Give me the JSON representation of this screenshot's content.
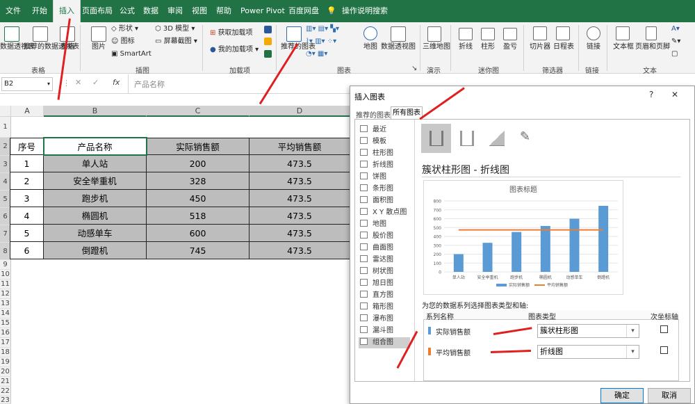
{
  "menu": {
    "tabs": [
      "文件",
      "开始",
      "插入",
      "页面布局",
      "公式",
      "数据",
      "审阅",
      "视图",
      "帮助",
      "Power Pivot",
      "百度网盘"
    ],
    "tell_me": "操作说明搜索"
  },
  "ribbon": {
    "pivot_table": "数据透视表",
    "recommended_pivot": "推荐的数据透视表",
    "table": "表格",
    "group_tables": "表格",
    "pictures": "图片",
    "shapes": "形状",
    "icons": "图标",
    "smartart": "SmartArt",
    "model3d": "3D 模型",
    "screenshot": "屏幕截图",
    "group_illustrations": "插图",
    "get_addins": "获取加载项",
    "my_addins": "我的加载项",
    "group_addins": "加载项",
    "recommended_charts": "推荐的图表",
    "group_charts": "图表",
    "map": "地图",
    "pivot_chart": "数据透视图",
    "map3d": "三维地图",
    "group_tours": "演示",
    "sp_line": "折线",
    "sp_column": "柱形",
    "sp_winloss": "盈亏",
    "group_sparklines": "迷你图",
    "slicer": "切片器",
    "timeline": "日程表",
    "group_filters": "筛选器",
    "link": "链接",
    "group_links": "链接",
    "textbox": "文本框",
    "header_footer": "页眉和页脚",
    "group_text": "文本"
  },
  "formula_bar": {
    "name_box": "B2",
    "fx": "fx",
    "content": "产品名称"
  },
  "sheet": {
    "columns": [
      "A",
      "B",
      "C",
      "D"
    ],
    "rows": [
      "1",
      "2",
      "3",
      "4",
      "5",
      "6",
      "7",
      "8",
      "9",
      "10",
      "11",
      "12",
      "13",
      "14",
      "15",
      "16",
      "17",
      "18",
      "19",
      "20",
      "21",
      "22",
      "23"
    ],
    "headers": [
      "序号",
      "产品名称",
      "实际销售额",
      "平均销售额"
    ],
    "data": [
      [
        "1",
        "单人站",
        "200",
        "473.5"
      ],
      [
        "2",
        "安全举重机",
        "328",
        "473.5"
      ],
      [
        "3",
        "跑步机",
        "450",
        "473.5"
      ],
      [
        "4",
        "椭圆机",
        "518",
        "473.5"
      ],
      [
        "5",
        "动感单车",
        "600",
        "473.5"
      ],
      [
        "6",
        "倒蹬机",
        "745",
        "473.5"
      ]
    ]
  },
  "dialog": {
    "title": "插入图表",
    "help": "?",
    "close": "✕",
    "tabs": [
      "推荐的图表",
      "所有图表"
    ],
    "types": [
      "最近",
      "模板",
      "柱形图",
      "折线图",
      "饼图",
      "条形图",
      "面积图",
      "X Y 散点图",
      "地图",
      "股价图",
      "曲面图",
      "雷达图",
      "树状图",
      "旭日图",
      "直方图",
      "箱形图",
      "瀑布图",
      "漏斗图",
      "组合图"
    ],
    "combo_title": "簇状柱形图 - 折线图",
    "series_prompt": "为您的数据系列选择图表类型和轴:",
    "col_series": "系列名称",
    "col_type": "图表类型",
    "col_axis": "次坐标轴",
    "series": [
      {
        "name": "实际销售额",
        "type": "簇状柱形图",
        "color": "#5b9bd5"
      },
      {
        "name": "平均销售额",
        "type": "折线图",
        "color": "#ed7d31"
      }
    ],
    "ok": "确定",
    "cancel": "取消"
  },
  "chart_data": {
    "type": "bar",
    "title": "图表标题",
    "categories": [
      "单人站",
      "安全举重机",
      "跑步机",
      "椭圆机",
      "动感单车",
      "倒蹬机"
    ],
    "series": [
      {
        "name": "实际销售额",
        "type": "bar",
        "color": "#5b9bd5",
        "values": [
          200,
          328,
          450,
          518,
          600,
          745
        ]
      },
      {
        "name": "平均销售额",
        "type": "line",
        "color": "#ed7d31",
        "values": [
          473.5,
          473.5,
          473.5,
          473.5,
          473.5,
          473.5
        ]
      }
    ],
    "ylim": [
      0,
      800
    ],
    "yticks": [
      "0",
      "100",
      "200",
      "300",
      "400",
      "500",
      "600",
      "700",
      "800"
    ],
    "grid": true,
    "legend": "bottom"
  }
}
